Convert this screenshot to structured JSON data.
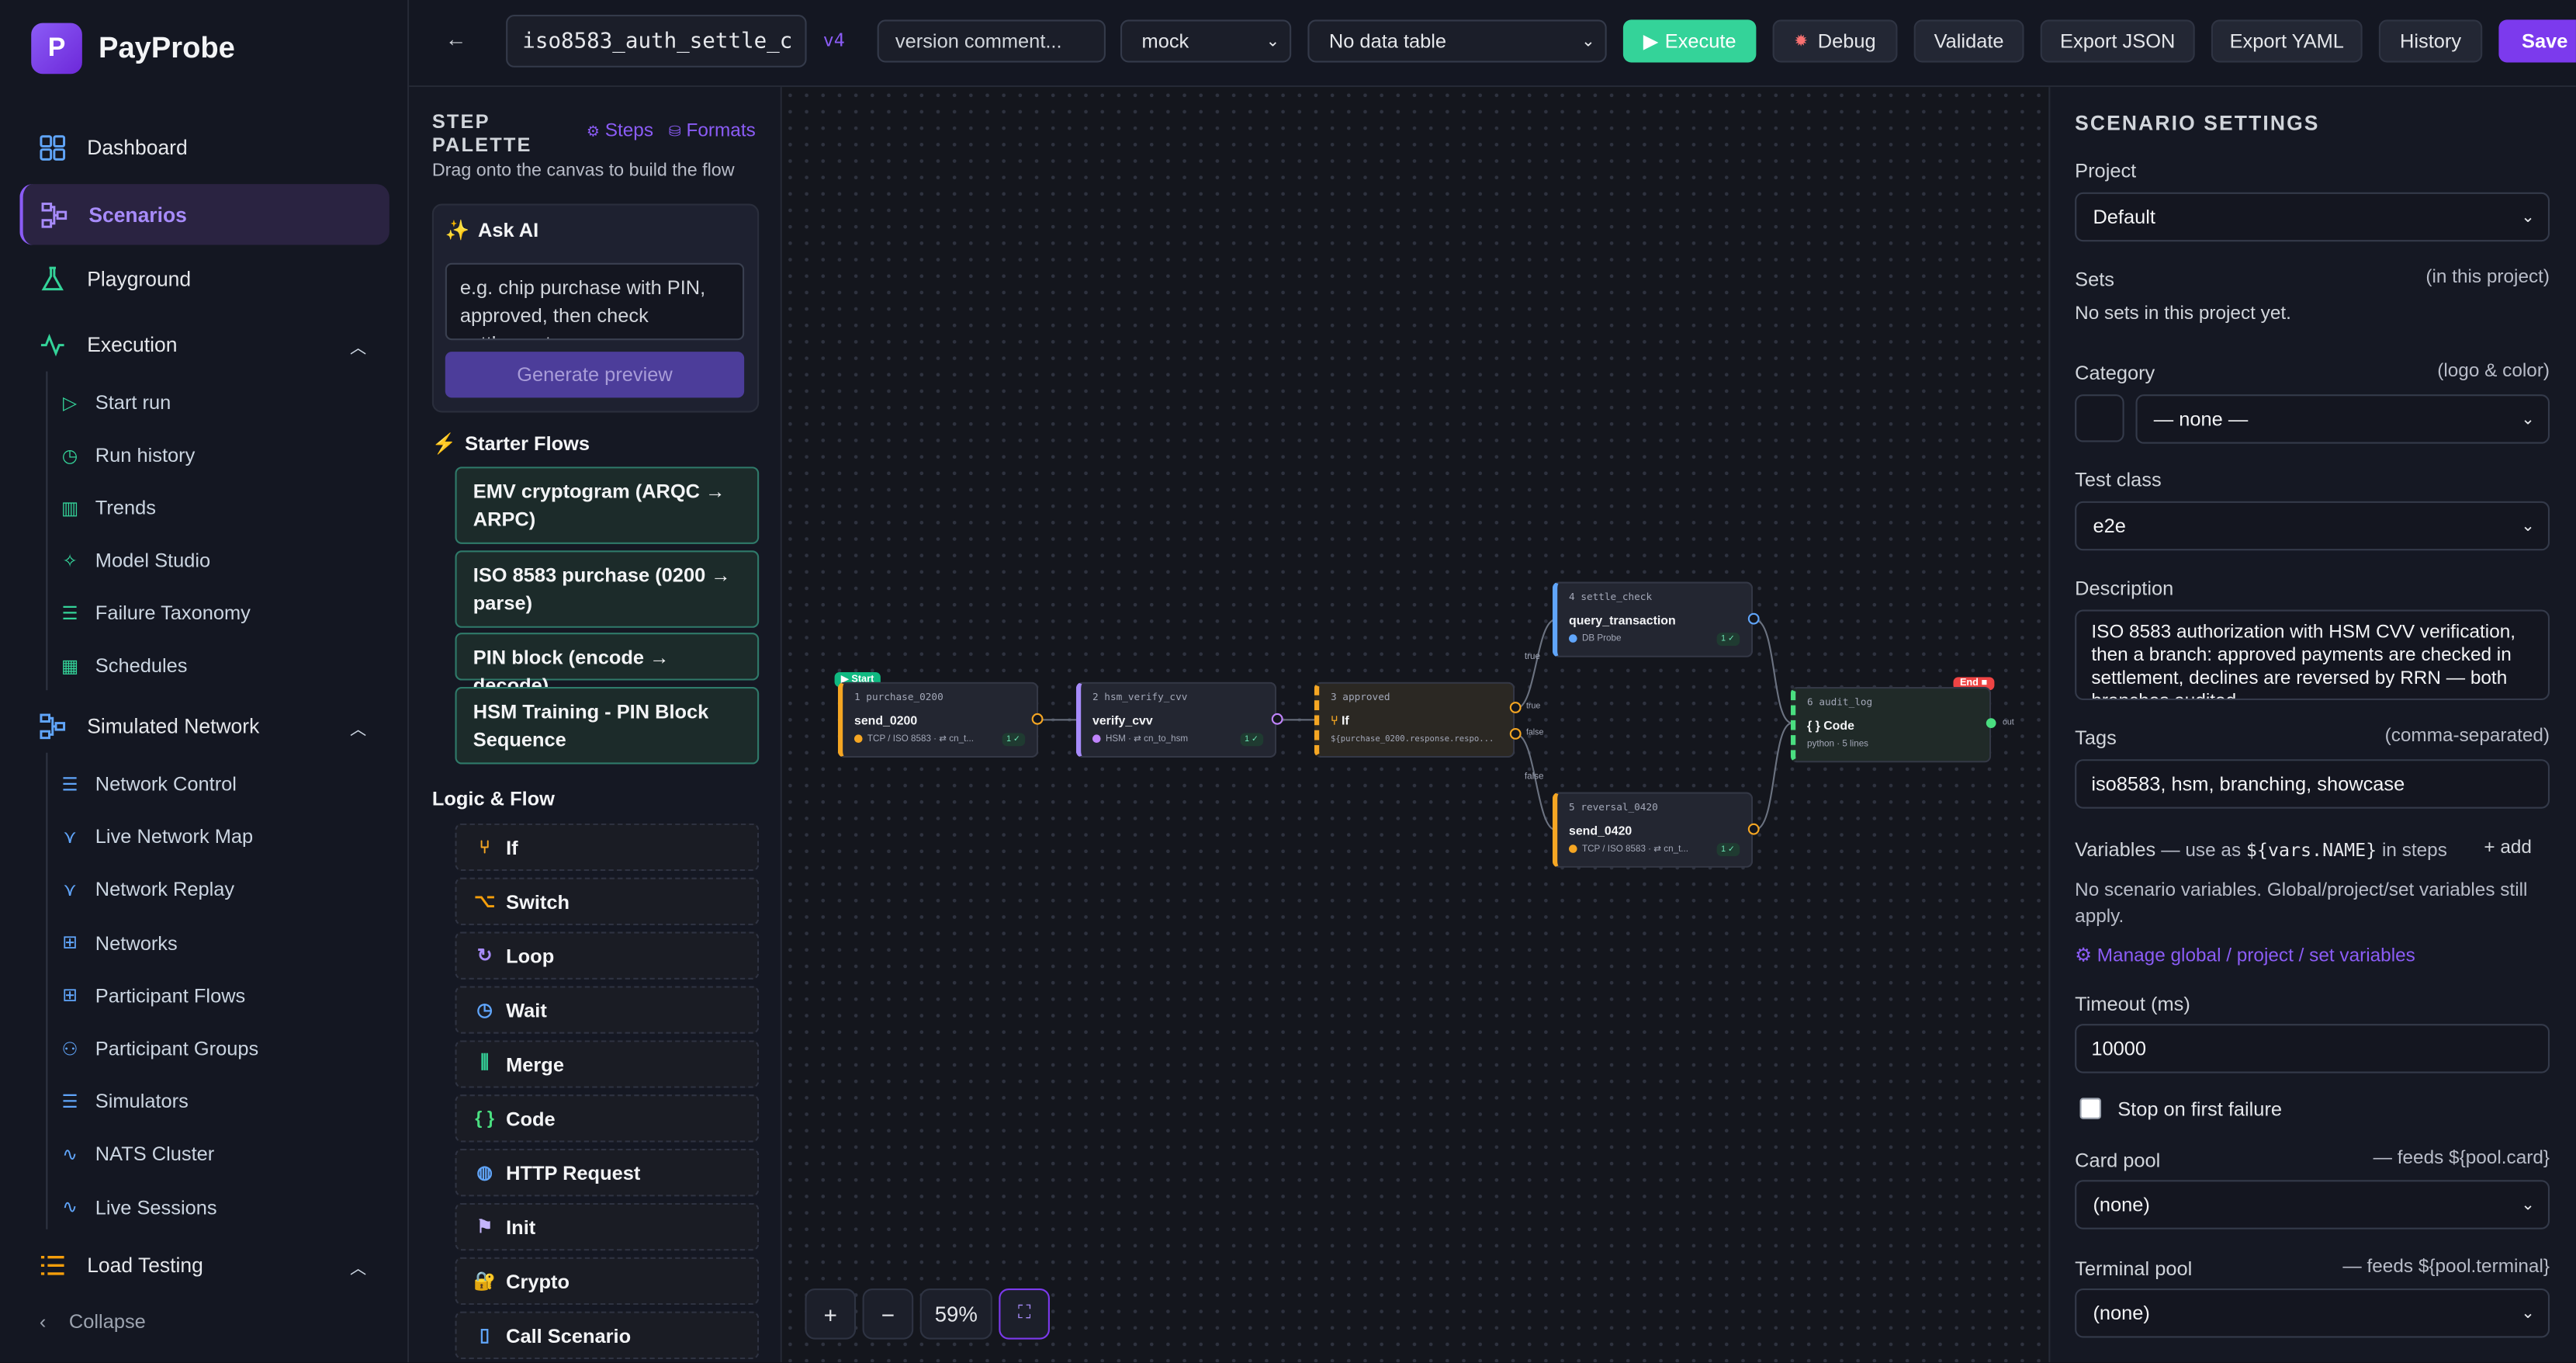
{
  "app": {
    "logo_letter": "P",
    "name": "PayProbe"
  },
  "sidebar": {
    "dashboard": "Dashboard",
    "scenarios": "Scenarios",
    "playground": "Playground",
    "execution": "Execution",
    "execution_items": [
      "Start run",
      "Run history",
      "Trends",
      "Model Studio",
      "Failure Taxonomy",
      "Schedules"
    ],
    "simulated_network": "Simulated Network",
    "network_items": [
      "Network Control",
      "Live Network Map",
      "Network Replay",
      "Networks",
      "Participant Flows",
      "Participant Groups",
      "Simulators",
      "NATS Cluster",
      "Live Sessions"
    ],
    "load_testing": "Load Testing",
    "collapse": "Collapse"
  },
  "topbar": {
    "back": "←",
    "scenario_name": "iso8583_auth_settle_c",
    "version": "v4",
    "version_comment_placeholder": "version comment...",
    "mode": "mock",
    "data_table": "No data table",
    "execute": "Execute",
    "debug": "Debug",
    "validate": "Validate",
    "export_json": "Export JSON",
    "export_yaml": "Export YAML",
    "history": "History",
    "save": "Save"
  },
  "palette": {
    "title_line1": "STEP",
    "title_line2": "PALETTE",
    "tab_steps": "Steps",
    "tab_formats": "Formats",
    "subtitle": "Drag onto the canvas to build the flow",
    "ask_ai": "Ask AI",
    "ask_ai_placeholder": "e.g. chip purchase with PIN, approved, then check settlement",
    "generate": "Generate preview",
    "starter_title": "Starter Flows",
    "starters": [
      "EMV cryptogram (ARQC → ARPC)",
      "ISO 8583 purchase (0200 → parse)",
      "PIN block (encode → decode)",
      "HSM Training - PIN Block Sequence"
    ],
    "logic_title": "Logic & Flow",
    "logic": [
      "If",
      "Switch",
      "Loop",
      "Wait",
      "Merge",
      "Code",
      "HTTP Request",
      "Init",
      "Crypto",
      "Call Scenario"
    ],
    "logic_colors": [
      "#f5a623",
      "#f59e0b",
      "#a78bfa",
      "#60a5fa",
      "#34d399",
      "#4ade80",
      "#60a5fa",
      "#c4b5fd",
      "#fbbf24",
      "#60a5fa"
    ]
  },
  "canvas": {
    "start_badge": "▶ Start",
    "end_badge": "End ■",
    "nodes": [
      {
        "id": "1 purchase_0200",
        "title": "send_0200",
        "meta": "TCP / ISO 8583 · ⇄ cn_t...",
        "badge": "1 ✓"
      },
      {
        "id": "2 hsm_verify_cvv",
        "title": "verify_cvv",
        "meta": "HSM · ⇄ cn_to_hsm",
        "badge": "1 ✓"
      },
      {
        "id": "3 approved",
        "title": "If",
        "meta": "${purchase_0200.response.respo...",
        "badge": ""
      },
      {
        "id": "4 settle_check",
        "title": "query_transaction",
        "meta": "DB Probe",
        "badge": "1 ✓"
      },
      {
        "id": "5 reversal_0420",
        "title": "send_0420",
        "meta": "TCP / ISO 8583 · ⇄ cn_t...",
        "badge": "1 ✓"
      },
      {
        "id": "6 audit_log",
        "title": "{ } Code",
        "meta": "python · 5 lines",
        "badge": ""
      }
    ],
    "edge_labels": {
      "true_top": "true",
      "false_top": "false",
      "true_out": "true",
      "false_bottom": "false",
      "out": "out"
    },
    "zoom": "59%"
  },
  "settings": {
    "title": "SCENARIO SETTINGS",
    "project_label": "Project",
    "project": "Default",
    "sets_label": "Sets",
    "sets_hint": "(in this project)",
    "sets_empty": "No sets in this project yet.",
    "category_label": "Category",
    "category_hint": "(logo & color)",
    "category": "— none —",
    "test_class_label": "Test class",
    "test_class": "e2e",
    "description_label": "Description",
    "description": "ISO 8583 authorization with HSM CVV verification, then a branch: approved payments are checked in settlement, declines are reversed by RRN — both branches audited.",
    "tags_label": "Tags",
    "tags_hint": "(comma-separated)",
    "tags": "iso8583, hsm, branching, showcase",
    "variables_label": "Variables",
    "variables_hint_pre": "— use as",
    "variables_code": "${vars.NAME}",
    "variables_hint_post": "in steps",
    "add": "+ add",
    "variables_empty": "No scenario variables. Global/project/set variables still apply.",
    "manage_link": "⚙ Manage global / project / set variables",
    "timeout_label": "Timeout (ms)",
    "timeout": "10000",
    "stop_label": "Stop on first failure",
    "card_pool_label": "Card pool",
    "card_pool_hint": "— feeds ${pool.card}",
    "card_pool": "(none)",
    "terminal_pool_label": "Terminal pool",
    "terminal_pool_hint": "— feeds ${pool.terminal}",
    "terminal_pool": "(none)"
  },
  "colors": {
    "accent": "#8b5cf6",
    "execute": "#34d399",
    "start": "#10b981",
    "end": "#ef4444",
    "port": "#f5a623"
  }
}
